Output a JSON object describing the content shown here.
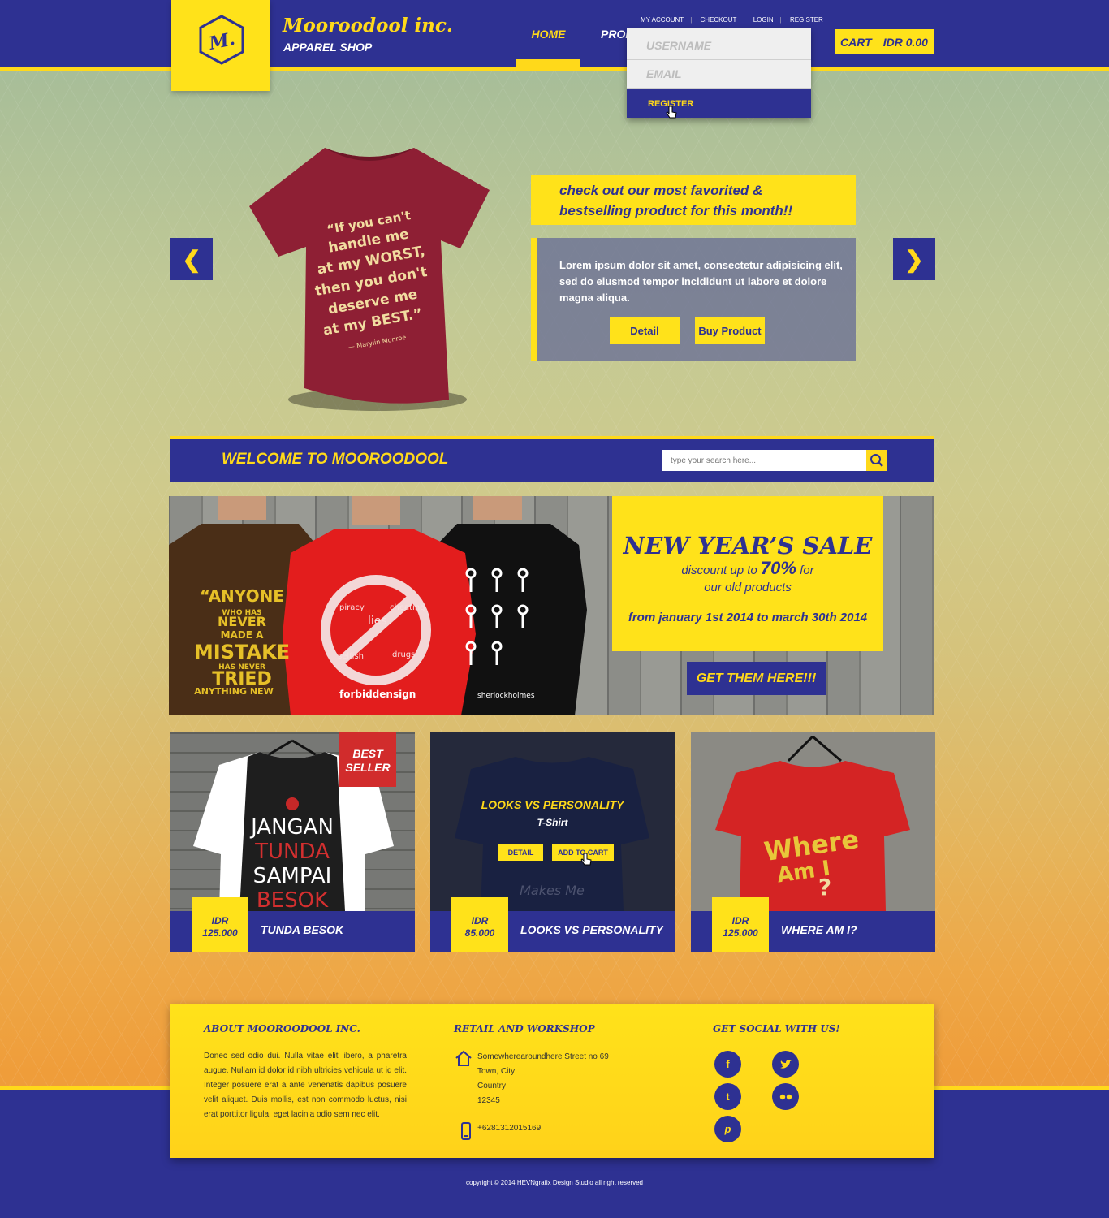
{
  "header": {
    "logo_letter": "M.",
    "brand_name": "Mooroodool inc.",
    "brand_sub": "APPAREL SHOP",
    "nav": {
      "home": "HOME",
      "products_partial": "PROD"
    },
    "top_links": [
      "MY ACCOUNT",
      "CHECKOUT",
      "LOGIN",
      "REGISTER"
    ],
    "cart": {
      "label": "CART",
      "amount": "IDR 0.00"
    }
  },
  "register_dropdown": {
    "username_placeholder": "USERNAME",
    "email_placeholder": "EMAIL",
    "button": "REGISTER"
  },
  "hero": {
    "headline_line1": "check out our most favorited &",
    "headline_line2": "bestselling product for this month!!",
    "body": "Lorem ipsum dolor sit amet, consectetur adipisicing elit, sed do eiusmod tempor incididunt ut labore et dolore magna aliqua.",
    "detail_button": "Detail",
    "buy_button": "Buy Product",
    "prev_arrow": "❮",
    "next_arrow": "❯",
    "shirt_text": [
      "“If you can't",
      "handle me",
      "at my WORST,",
      "then you don't",
      "deserve me",
      "at my BEST.”",
      "— Marylin Monroe"
    ]
  },
  "welcome": {
    "title": "WELCOME TO MOOROODOOL",
    "search_placeholder": "type your search here..."
  },
  "sale": {
    "title": "NEW YEAR’S SALE",
    "line1_pre": "discount up to",
    "percent": "70%",
    "line1_post": "for",
    "line2": "our old products",
    "dates": "from january 1st 2014 to march 30th 2014",
    "cta": "GET THEM HERE!!!",
    "shirt1_text": [
      "“ANYONE",
      "WHO HAS",
      "NEVER",
      "MADE A",
      "MISTAKE",
      "HAS NEVER",
      "TRIED",
      "ANYTHING NEW"
    ],
    "shirt2_label": "forbiddensign",
    "shirt2_words": [
      "piracy",
      "lies",
      "cheating",
      "selfish",
      "drugs"
    ],
    "shirt3_label": "sherlockholmes"
  },
  "products": [
    {
      "price_cur": "IDR",
      "price": "125.000",
      "name": "TUNDA BESOK",
      "badge_line1": "BEST",
      "badge_line2": "SELLER",
      "shirt_lines": [
        "JANGAN",
        "TUNDA",
        "SAMPAI",
        "BESOK"
      ]
    },
    {
      "price_cur": "IDR",
      "price": "85.000",
      "name": "LOOKS VS PERSONALITY",
      "overlay_title": "LOOKS VS PERSONALITY",
      "overlay_sub": "T-Shirt",
      "detail": "DETAIL",
      "add_to_cart": "ADD TO CART"
    },
    {
      "price_cur": "IDR",
      "price": "125.000",
      "name": "WHERE AM I?",
      "shirt_lines": [
        "Where",
        "Am I",
        "?"
      ]
    }
  ],
  "footer": {
    "about_title": "ABOUT MOOROODOOL INC.",
    "about_text": "Donec sed odio dui. Nulla vitae elit libero, a pharetra augue. Nullam id dolor id nibh ultricies vehicula ut id elit. Integer posuere erat a ante venenatis dapibus posuere velit aliquet. Duis mollis, est non commodo luctus, nisi erat porttitor ligula, eget lacinia odio sem nec elit.",
    "retail_title": "RETAIL AND WORKSHOP",
    "address": [
      "Somewherearoundhere Street no 69",
      "Town, City",
      "Country",
      "12345"
    ],
    "phone": "+6281312015169",
    "social_title": "GET SOCIAL WITH US!",
    "social": [
      "f",
      "t",
      "p"
    ],
    "copyright": "copyright © 2014 HEVNgrafix Design Studio all right reserved"
  },
  "colors": {
    "brand_blue": "#2e3192",
    "brand_yellow": "#ffe21a",
    "badge_red": "#d12c2c"
  }
}
